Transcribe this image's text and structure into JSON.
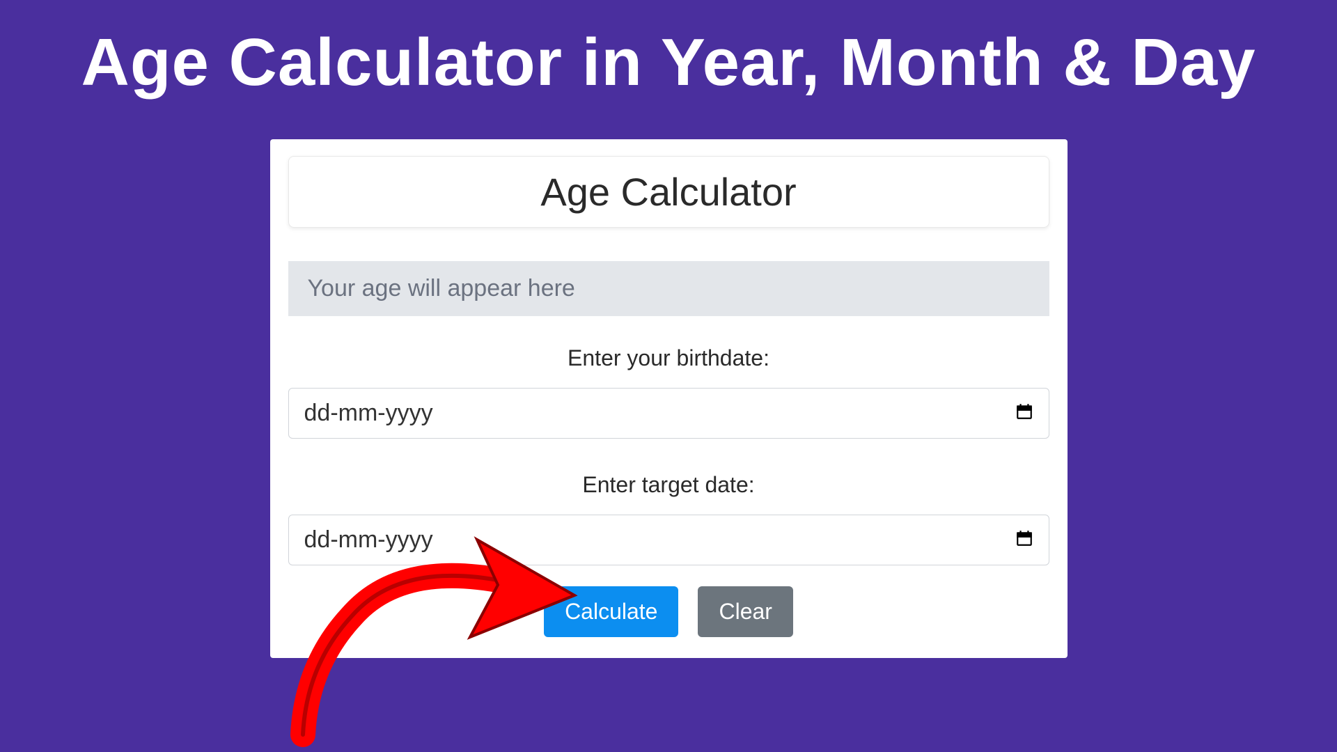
{
  "page": {
    "title": "Age Calculator in Year, Month & Day"
  },
  "card": {
    "header": "Age Calculator",
    "result_placeholder": "Your age will appear here",
    "birthdate_label": "Enter your birthdate:",
    "birthdate_placeholder": "dd-mm-yyyy",
    "target_label": "Enter target date:",
    "target_placeholder": "dd-mm-yyyy",
    "calculate_label": "Calculate",
    "clear_label": "Clear"
  },
  "colors": {
    "background": "#4a2f9e",
    "primary_button": "#0c8ef0",
    "secondary_button": "#6c757d",
    "arrow": "#ff0000"
  }
}
